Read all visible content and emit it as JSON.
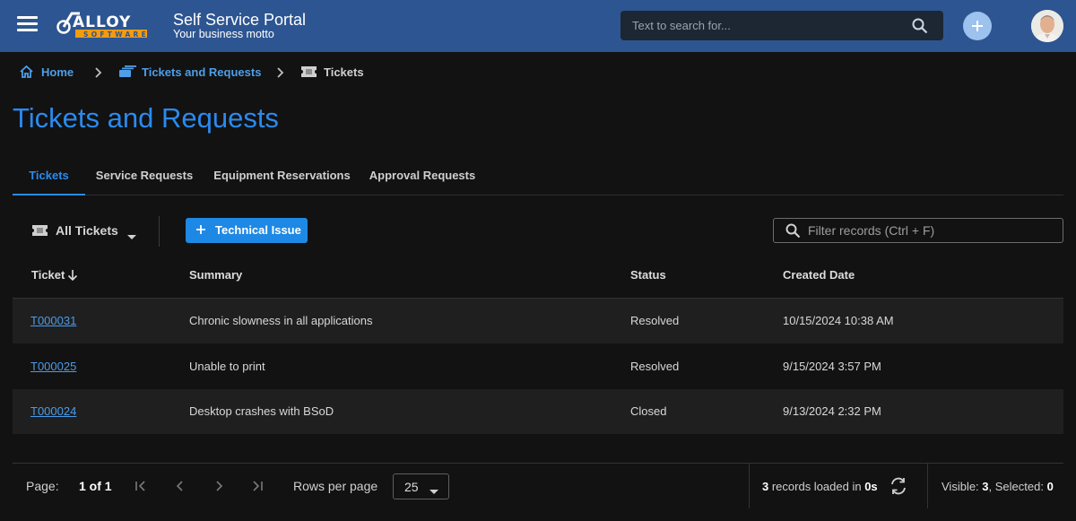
{
  "header": {
    "logo": {
      "text": "ALLOY",
      "sub": "SOFTWARE"
    },
    "title": "Self Service Portal",
    "motto": "Your business motto",
    "search_placeholder": "Text to search for...",
    "menu_icon": "hamburger-menu-icon",
    "search_icon": "search-icon",
    "add_icon": "plus-icon"
  },
  "breadcrumb": [
    {
      "label": "Home",
      "icon": "home-icon"
    },
    {
      "label": "Tickets and Requests",
      "icon": "tickets-requests-icon"
    },
    {
      "label": "Tickets",
      "icon": "ticket-icon"
    }
  ],
  "page_title": "Tickets and Requests",
  "tabs": [
    {
      "label": "Tickets",
      "active": true
    },
    {
      "label": "Service Requests",
      "active": false
    },
    {
      "label": "Equipment Reservations",
      "active": false
    },
    {
      "label": "Approval Requests",
      "active": false
    }
  ],
  "toolbar": {
    "view_label": "All Tickets",
    "new_button_label": "Technical Issue",
    "filter_placeholder": "Filter records (Ctrl + F)"
  },
  "table": {
    "columns": [
      "Ticket",
      "Summary",
      "Status",
      "Created Date"
    ],
    "sorted_column": "Ticket",
    "rows": [
      {
        "ticket": "T000031",
        "summary": "Chronic slowness in all applications",
        "status": "Resolved",
        "created": "10/15/2024 10:38 AM"
      },
      {
        "ticket": "T000025",
        "summary": "Unable to print",
        "status": "Resolved",
        "created": "9/15/2024 3:57 PM"
      },
      {
        "ticket": "T000024",
        "summary": "Desktop crashes with BSoD",
        "status": "Closed",
        "created": "9/13/2024 2:32 PM"
      }
    ]
  },
  "footer": {
    "page_label": "Page:",
    "page_value": "1 of 1",
    "rows_per_page_label": "Rows per page",
    "rows_per_page_value": "25",
    "records_count": "3",
    "records_text": " records loaded in ",
    "records_time": "0s",
    "visible_label": "Visible: ",
    "visible_value": "3",
    "selected_label": ", Selected: ",
    "selected_value": "0"
  },
  "colors": {
    "header_bg": "#2d5591",
    "accent": "#2b8af0",
    "link": "#4c9be8",
    "button": "#1e88e5",
    "logo_orange": "#f39c12"
  }
}
